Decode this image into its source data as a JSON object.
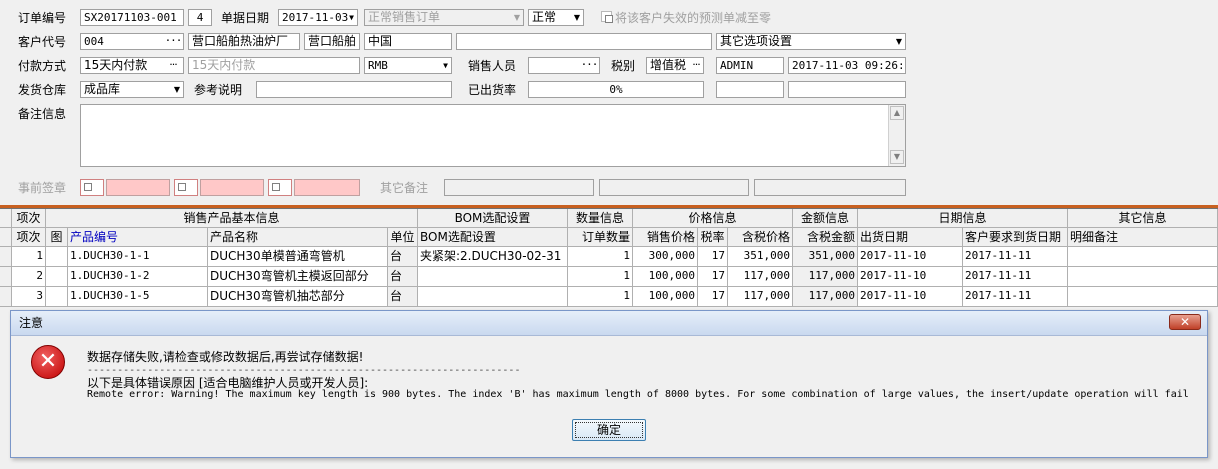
{
  "form": {
    "order_no_label": "订单编号",
    "order_no": "SX20171103-001",
    "order_seq": "4",
    "date_label": "单据日期",
    "date": "2017-11-03",
    "order_type": "正常销售订单",
    "status": "正常",
    "exclude_label": "将该客户失效的预测单减至零",
    "customer_code_label": "客户代号",
    "customer_code": "004",
    "customer_name": "营口船舶热油炉厂",
    "customer_short": "营口船舶",
    "country": "中国",
    "other_options": "其它选项设置",
    "payment_label": "付款方式",
    "payment": "15天内付款",
    "payment_desc": "15天内付款",
    "currency": "RMB",
    "sales_label": "销售人员",
    "tax_label": "税别",
    "tax_type": "增值税",
    "operator": "ADMIN",
    "timestamp": "2017-11-03 09:26:54",
    "warehouse_label": "发货仓库",
    "warehouse": "成品库",
    "ref_label": "参考说明",
    "shipped_label": "已出货率",
    "shipped_rate": "0%",
    "remark_label": "备注信息",
    "pre_sign_label": "事前签章",
    "other_remark_label": "其它备注"
  },
  "grid": {
    "groups": [
      "项次",
      "销售产品基本信息",
      "BOM选配设置",
      "数量信息",
      "价格信息",
      "金额信息",
      "日期信息",
      "其它信息"
    ],
    "columns": [
      "项次",
      "图",
      "产品编号",
      "产品名称",
      "单位",
      "BOM选配设置",
      "订单数量",
      "销售价格",
      "税率",
      "含税价格",
      "含税金额",
      "出货日期",
      "客户要求到货日期",
      "明细备注"
    ],
    "rows": [
      {
        "seq": "1",
        "code": "1.DUCH30-1-1",
        "name": "DUCH30单模普通弯管机",
        "unit": "台",
        "bom": "夹紧架:2.DUCH30-02-31",
        "qty": "1",
        "price": "300,000",
        "tax": "17",
        "tax_price": "351,000",
        "amount": "351,000",
        "ship_date": "2017-11-10",
        "req_date": "2017-11-11",
        "note": ""
      },
      {
        "seq": "2",
        "code": "1.DUCH30-1-2",
        "name": "DUCH30弯管机主模返回部分",
        "unit": "台",
        "bom": "",
        "qty": "1",
        "price": "100,000",
        "tax": "17",
        "tax_price": "117,000",
        "amount": "117,000",
        "ship_date": "2017-11-10",
        "req_date": "2017-11-11",
        "note": ""
      },
      {
        "seq": "3",
        "code": "1.DUCH30-1-5",
        "name": "DUCH30弯管机抽芯部分",
        "unit": "台",
        "bom": "",
        "qty": "1",
        "price": "100,000",
        "tax": "17",
        "tax_price": "117,000",
        "amount": "117,000",
        "ship_date": "2017-11-10",
        "req_date": "2017-11-11",
        "note": ""
      }
    ]
  },
  "dialog": {
    "title": "注意",
    "close": "✕",
    "message": "数据存储失败,请检查或修改数据后,再尝试存储数据!",
    "separator": "------------------------------------------------------------------------",
    "detail_title": "以下是具体错误原因 [适合电脑维护人员或开发人员]:",
    "detail": "Remote error: Warning! The maximum key length is 900 bytes. The index 'B' has maximum length of 8000 bytes. For some combination of large values, the insert/update operation will fail",
    "ok_label": "确定"
  },
  "icons": {
    "error": "error-x-icon",
    "dropdown": "chevron-down-icon",
    "ellipsis": "ellipsis-icon",
    "close": "close-icon"
  },
  "colors": {
    "accent_line": "#c86020",
    "required": "#ffc8c8",
    "error": "#c00000"
  }
}
